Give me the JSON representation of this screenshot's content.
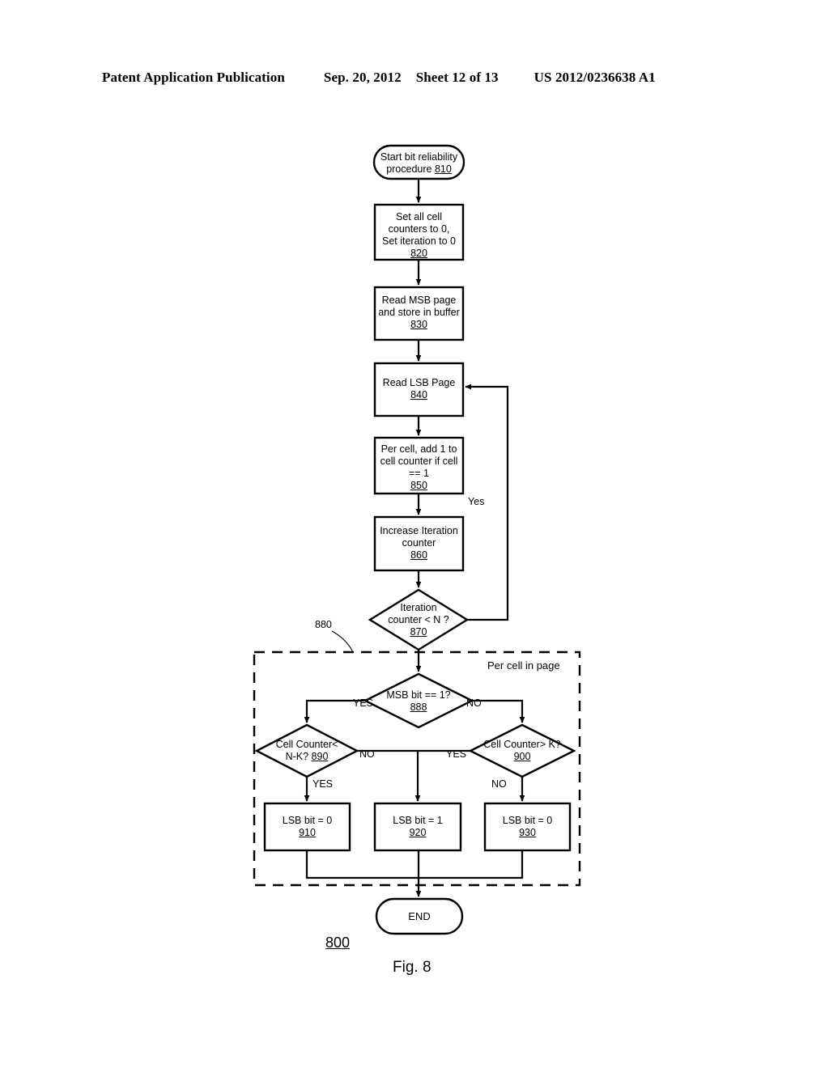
{
  "header": {
    "publication": "Patent Application Publication",
    "date": "Sep. 20, 2012",
    "sheet": "Sheet 12 of 13",
    "number": "US 2012/0236638 A1"
  },
  "figure": {
    "caption": "Fig. 8",
    "figure_ref": "800",
    "group_ref": "880",
    "group_label": "Per cell in page"
  },
  "nodes": {
    "start": {
      "shape": "rounded-terminator",
      "line1": "Start bit reliability",
      "line2": "procedure ",
      "ref": "810"
    },
    "step820": {
      "shape": "process",
      "line1": "Set all cell",
      "line2": "counters to 0,",
      "line3": "Set iteration to 0",
      "ref": "820"
    },
    "step830": {
      "shape": "process",
      "line1": "Read MSB page",
      "line2": "and store in buffer",
      "ref": "830"
    },
    "step840": {
      "shape": "process",
      "line1": "Read LSB Page",
      "ref": "840"
    },
    "step850": {
      "shape": "process",
      "line1": "Per cell, add 1 to",
      "line2": "cell counter if cell",
      "line3": "== 1",
      "ref": "850"
    },
    "step860": {
      "shape": "process",
      "line1": "Increase Iteration",
      "line2": "counter",
      "ref": "860"
    },
    "decision870": {
      "shape": "decision",
      "line1": "Iteration",
      "line2": "counter < N ?",
      "ref": "870"
    },
    "decision888": {
      "shape": "decision",
      "line1": "MSB bit == 1?",
      "ref": "888"
    },
    "decision890": {
      "shape": "decision",
      "line1": "Cell Counter<",
      "line2": "N-K? ",
      "ref": "890"
    },
    "decision900": {
      "shape": "decision",
      "line1": "Cell Counter> K?",
      "ref": "900"
    },
    "step910": {
      "shape": "process",
      "line1": "LSB bit = 0",
      "ref": "910"
    },
    "step920": {
      "shape": "process",
      "line1": "LSB bit = 1",
      "ref": "920"
    },
    "step930": {
      "shape": "process",
      "line1": "LSB bit = 0",
      "ref": "930"
    },
    "end": {
      "shape": "rounded-terminator",
      "line1": "END"
    }
  },
  "edge_labels": {
    "loop_yes": "Yes",
    "msb_yes": "YES",
    "msb_no": "NO",
    "cc890_no": "NO",
    "cc890_yes": "YES",
    "cc900_yes": "YES",
    "cc900_no": "NO"
  },
  "colors": {
    "ink": "#000000",
    "paper": "#ffffff"
  }
}
